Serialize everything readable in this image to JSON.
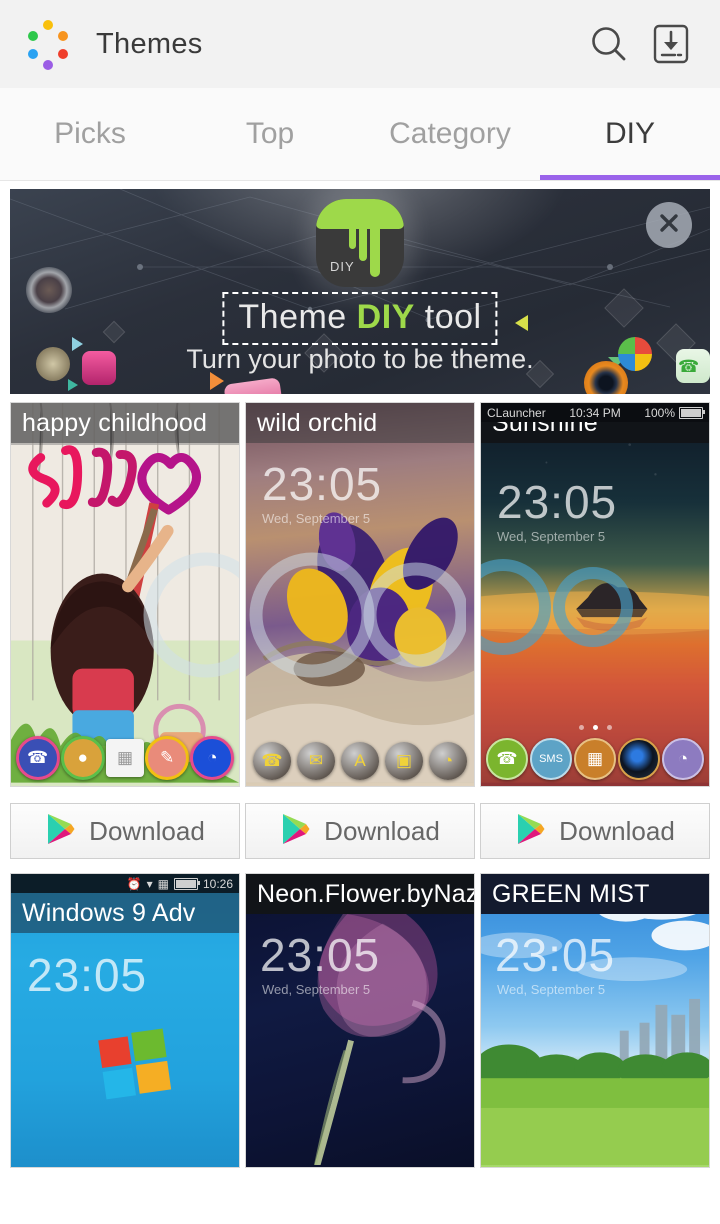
{
  "header": {
    "app_title": "Themes",
    "logo_name": "themes-dots-logo",
    "logo_colors": [
      "#f9c00c",
      "#f7941e",
      "#ef3e2b",
      "#9b5de5",
      "#2aa2f2",
      "#2ec84b"
    ],
    "search_icon": "search-icon",
    "downloads_icon": "my-downloads-icon"
  },
  "tabs": {
    "accent_color": "#9a63ea",
    "items": [
      {
        "label": "Picks",
        "active": false
      },
      {
        "label": "Top",
        "active": false
      },
      {
        "label": "Category",
        "active": false
      },
      {
        "label": "DIY",
        "active": true
      }
    ]
  },
  "banner": {
    "title_plain_1": "Theme ",
    "title_highlight": "DIY",
    "title_plain_2": " tool",
    "subtitle": "Turn your photo to be theme.",
    "badge_label": "DIY",
    "close_icon": "close-icon",
    "highlight_color": "#9ed94a"
  },
  "themes": [
    {
      "title": "happy childhood",
      "title_style": "band",
      "clock": "",
      "date": "",
      "statusbar": null,
      "download_label": "Download",
      "dock": [
        {
          "name": "phone-icon",
          "glyph": "☎",
          "bg": "#3a4fb5"
        },
        {
          "name": "contacts-icon",
          "glyph": "●",
          "bg": "#d9a23b"
        },
        {
          "name": "app-drawer-icon",
          "glyph": "☷",
          "bg": "#f4f4f4"
        },
        {
          "name": "messages-icon",
          "glyph": "✎",
          "bg": "#e98b7a"
        },
        {
          "name": "browser-icon",
          "glyph": "◔",
          "bg": "#1b4fd8"
        }
      ]
    },
    {
      "title": "wild orchid",
      "title_style": "band",
      "clock": "23:05",
      "date": "Wed, September 5",
      "statusbar": null,
      "download_label": "Download",
      "dock": [
        {
          "name": "phone-icon",
          "glyph": "☎",
          "bg": "#4b4238"
        },
        {
          "name": "mail-icon",
          "glyph": "✉",
          "bg": "#4b4238"
        },
        {
          "name": "appstore-icon",
          "glyph": "A",
          "bg": "#4b4238"
        },
        {
          "name": "calendar-icon",
          "glyph": "☷",
          "bg": "#4b4238"
        },
        {
          "name": "browser-icon",
          "glyph": "◔",
          "bg": "#4b4238"
        }
      ]
    },
    {
      "title": "Sunshine",
      "title_style": "dark",
      "clock": "23:05",
      "date": "Wed, September 5",
      "statusbar": {
        "carrier": "CLauncher",
        "time": "10:34 PM",
        "battery": "100%"
      },
      "download_label": "Download",
      "dock": [
        {
          "name": "phone-icon",
          "glyph": "☎",
          "bg": "#7bb52e"
        },
        {
          "name": "sms-icon",
          "glyph": "✉",
          "bg": "#5da3c6"
        },
        {
          "name": "app-drawer-icon",
          "glyph": "☷",
          "bg": "#c97f2a"
        },
        {
          "name": "camera-icon",
          "glyph": "◉",
          "bg": "#1b2733"
        },
        {
          "name": "browser-icon",
          "glyph": "◔",
          "bg": "#8d7bc0"
        }
      ]
    },
    {
      "title": "Windows 9 Adv",
      "title_style": "band",
      "clock": "23:05",
      "date": "",
      "statusbar": {
        "carrier": "",
        "time": "10:26",
        "battery": ""
      },
      "download_label": "Download",
      "dock": []
    },
    {
      "title": "Neon.Flower.byNaz",
      "title_style": "dark",
      "clock": "23:05",
      "date": "Wed, September 5",
      "statusbar": null,
      "download_label": "Download",
      "dock": []
    },
    {
      "title": "GREEN MIST",
      "title_style": "darkblue",
      "clock": "23:05",
      "date": "Wed, September 5",
      "statusbar": null,
      "download_label": "Download",
      "dock": []
    }
  ],
  "download_buttons": [
    {
      "label": "Download",
      "icon": "play-store-icon"
    },
    {
      "label": "Download",
      "icon": "play-store-icon"
    },
    {
      "label": "Download",
      "icon": "play-store-icon"
    }
  ]
}
